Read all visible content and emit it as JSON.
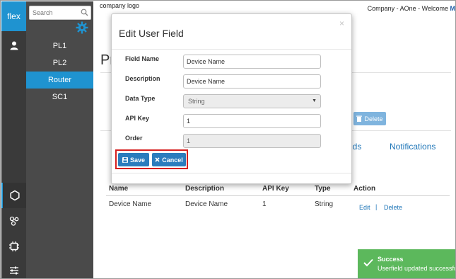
{
  "rail": {
    "brand": "flex",
    "icons": [
      "user-icon",
      "hexagon-icon",
      "share-nodes-icon",
      "chip-icon",
      "sliders-icon"
    ]
  },
  "sidebar": {
    "search_placeholder": "Search",
    "items": [
      {
        "label": "PL1"
      },
      {
        "label": "PL2"
      },
      {
        "label": "Router"
      },
      {
        "label": "SC1"
      }
    ],
    "active_item": "Router"
  },
  "header": {
    "logo_text": "company logo",
    "welcome_text": "Company - AOne - Welcome",
    "welcome_user": "M"
  },
  "page": {
    "title_partial": "Pr",
    "delete_label": "Delete",
    "tab_fields_partial": "lds",
    "tab_notifications": "Notifications"
  },
  "table": {
    "headers": [
      "Name",
      "Description",
      "API Key",
      "Type",
      "Action"
    ],
    "rows": [
      {
        "name": "Device Name",
        "description": "Device Name",
        "api_key": "1",
        "type": "String",
        "edit": "Edit",
        "separator": "|",
        "delete": "Delete"
      }
    ]
  },
  "modal": {
    "title": "Edit User Field",
    "close": "×",
    "fields": {
      "field_name": {
        "label": "Field Name",
        "value": "Device Name"
      },
      "description": {
        "label": "Description",
        "value": "Device Name"
      },
      "data_type": {
        "label": "Data Type",
        "value": "String"
      },
      "api_key": {
        "label": "API Key",
        "value": "1"
      },
      "order": {
        "label": "Order",
        "value": "1"
      }
    },
    "save_label": "Save",
    "cancel_label": "Cancel"
  },
  "toast": {
    "title": "Success",
    "message": "Userfield updated successfully"
  },
  "colors": {
    "brand_blue": "#1f93d0",
    "button_blue": "#2b7cbd",
    "success_green": "#5cb85c",
    "highlight_red": "#d62020"
  }
}
